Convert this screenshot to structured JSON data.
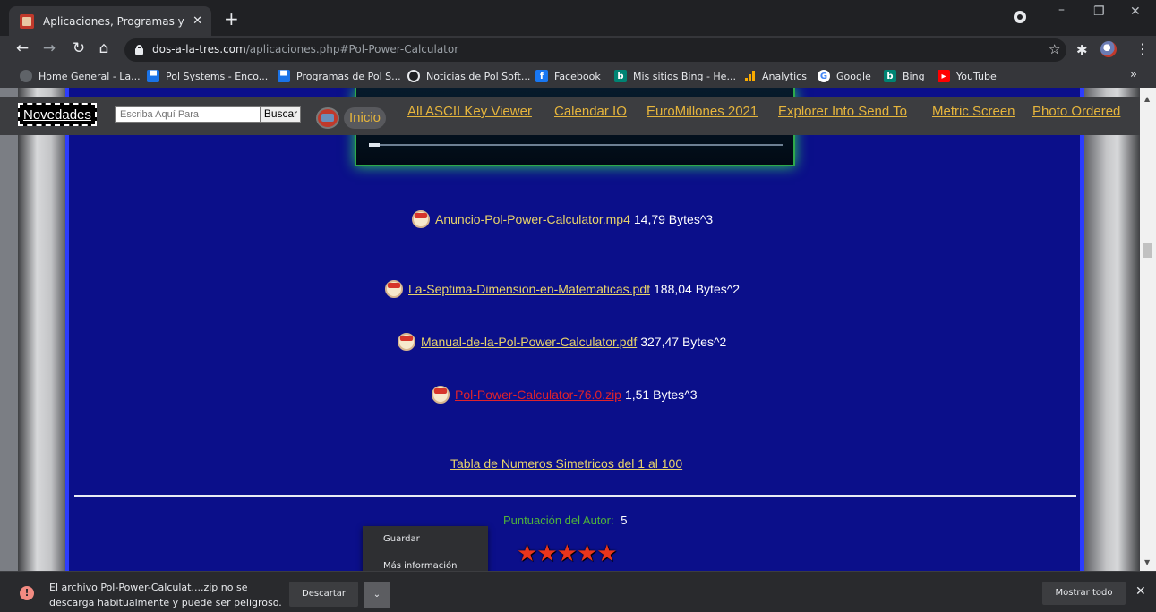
{
  "browser": {
    "tab_title": "Aplicaciones, Programas y Apps",
    "tab_close": "✕",
    "new_tab": "+",
    "url_host": "dos-a-la-tres.com",
    "url_path": "/aplicaciones.php#Pol-Power-Calculator",
    "bookmarks": [
      {
        "label": "Home General - La...",
        "icon": "globe-icon"
      },
      {
        "label": "Pol Systems - Enco...",
        "icon": "blogger-icon"
      },
      {
        "label": "Programas de Pol S...",
        "icon": "blogger-icon"
      },
      {
        "label": "Noticias de Pol Soft...",
        "icon": "camera-icon"
      },
      {
        "label": "Facebook",
        "icon": "facebook-icon"
      },
      {
        "label": "Mis sitios Bing - He...",
        "icon": "bing-icon"
      },
      {
        "label": "Analytics",
        "icon": "analytics-icon"
      },
      {
        "label": "Google",
        "icon": "google-icon"
      },
      {
        "label": "Bing",
        "icon": "bing-icon"
      },
      {
        "label": "YouTube",
        "icon": "youtube-icon"
      }
    ],
    "bookmarks_more": "»"
  },
  "site": {
    "novedades": "Novedades",
    "search_placeholder": "Escriba Aquí Para",
    "search_button": "Buscar",
    "inicio": "Inicio",
    "nav_links": [
      "All ASCII Key Viewer",
      "Calendar IO",
      "EuroMillones 2021",
      "Explorer Into Send To",
      "Metric Screen",
      "Photo Ordered"
    ],
    "files": [
      {
        "name": "Anuncio-Pol-Power-Calculator.mp4",
        "size": "14,79 Bytes^3"
      },
      {
        "name": "La-Septima-Dimension-en-Matematicas.pdf",
        "size": "188,04 Bytes^2"
      },
      {
        "name": "Manual-de-la-Pol-Power-Calculator.pdf",
        "size": "327,47 Bytes^2"
      },
      {
        "name": "Pol-Power-Calculator-76.0.zip",
        "size": "1,51 Bytes^3"
      }
    ],
    "tabla_link": "Tabla de Numeros Simetricos del 1 al 100",
    "puntuacion_label": "Puntuación del Autor:",
    "puntuacion_value": "5",
    "stars": 5
  },
  "context_menu": {
    "items": [
      "Guardar",
      "Más información"
    ]
  },
  "download_bar": {
    "message_line1": "El archivo Pol-Power-Calculat....zip no se",
    "message_line2": "descarga habitualmente y puede ser peligroso.",
    "discard": "Descartar",
    "show_all": "Mostrar todo",
    "close": "✕"
  },
  "colors": {
    "link": "#e8d36a",
    "visited_link": "#e0232b",
    "panel_blue": "#0b0f8a",
    "nav_link": "#e6b53c",
    "rating_label": "#4fb33b",
    "star": "#e9351d"
  }
}
